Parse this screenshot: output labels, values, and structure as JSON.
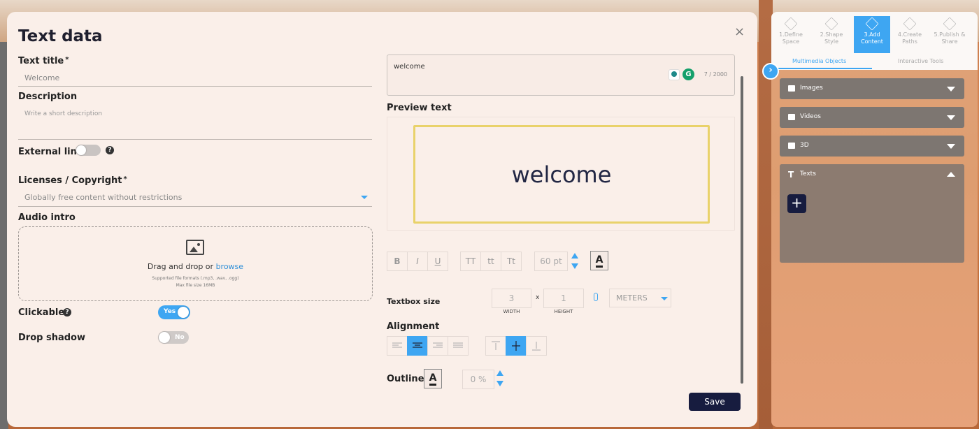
{
  "modal": {
    "title": "Text data",
    "close": "×",
    "text_title_label": "Text title",
    "required_mark": "*",
    "text_title_value": "Welcome",
    "description_label": "Description",
    "description_placeholder": "Write a short description",
    "external_link_label": "External link",
    "licenses_label": "Licenses / Copyright",
    "licenses_value": "Globally free content without restrictions",
    "audio_intro_label": "Audio intro",
    "dropzone": {
      "text": "Drag and drop or",
      "link": "browse",
      "formats": "Supported file formats (.mp3, .wav, .ogg)",
      "max_size": "Max file size 16MB"
    },
    "clickable_label": "Clickable",
    "clickable_value": "Yes",
    "drop_shadow_label": "Drop shadow",
    "drop_shadow_value": "No",
    "textarea_value": "welcome",
    "char_count": "7 / 2000",
    "preview_label": "Preview text",
    "preview_word": "welcome",
    "format": {
      "bold": "B",
      "italic": "I",
      "underline": "U",
      "upper": "TT",
      "lower": "tt",
      "title": "Tt",
      "size": "60",
      "size_unit": "pt",
      "color": "A"
    },
    "textbox_size_label": "Textbox size",
    "width_value": "3",
    "height_value": "1",
    "width_label": "WIDTH",
    "height_label": "HEIGHT",
    "times": "x",
    "unit_value": "METERS",
    "alignment_label": "Alignment",
    "outline_label": "Outline",
    "outline_color": "A",
    "outline_value": "0",
    "outline_unit": "%",
    "save": "Save"
  },
  "sidebar": {
    "steps": [
      {
        "label": "1.Define Space"
      },
      {
        "label": "2.Shape Style"
      },
      {
        "label": "3.Add Content"
      },
      {
        "label": "4.Create Paths"
      },
      {
        "label": "5.Publish & Share"
      }
    ],
    "tabs": {
      "multimedia": "Multimedia Objects",
      "interactive": "Interactive Tools"
    },
    "sections": {
      "images": "Images",
      "videos": "Videos",
      "three_d": "3D",
      "texts": "Texts"
    },
    "add": "+",
    "collapse_chevron": "›"
  },
  "colors": {
    "accent": "#3ea6f2",
    "primary_dark": "#171c3f",
    "preview_border": "#e9d26a"
  }
}
